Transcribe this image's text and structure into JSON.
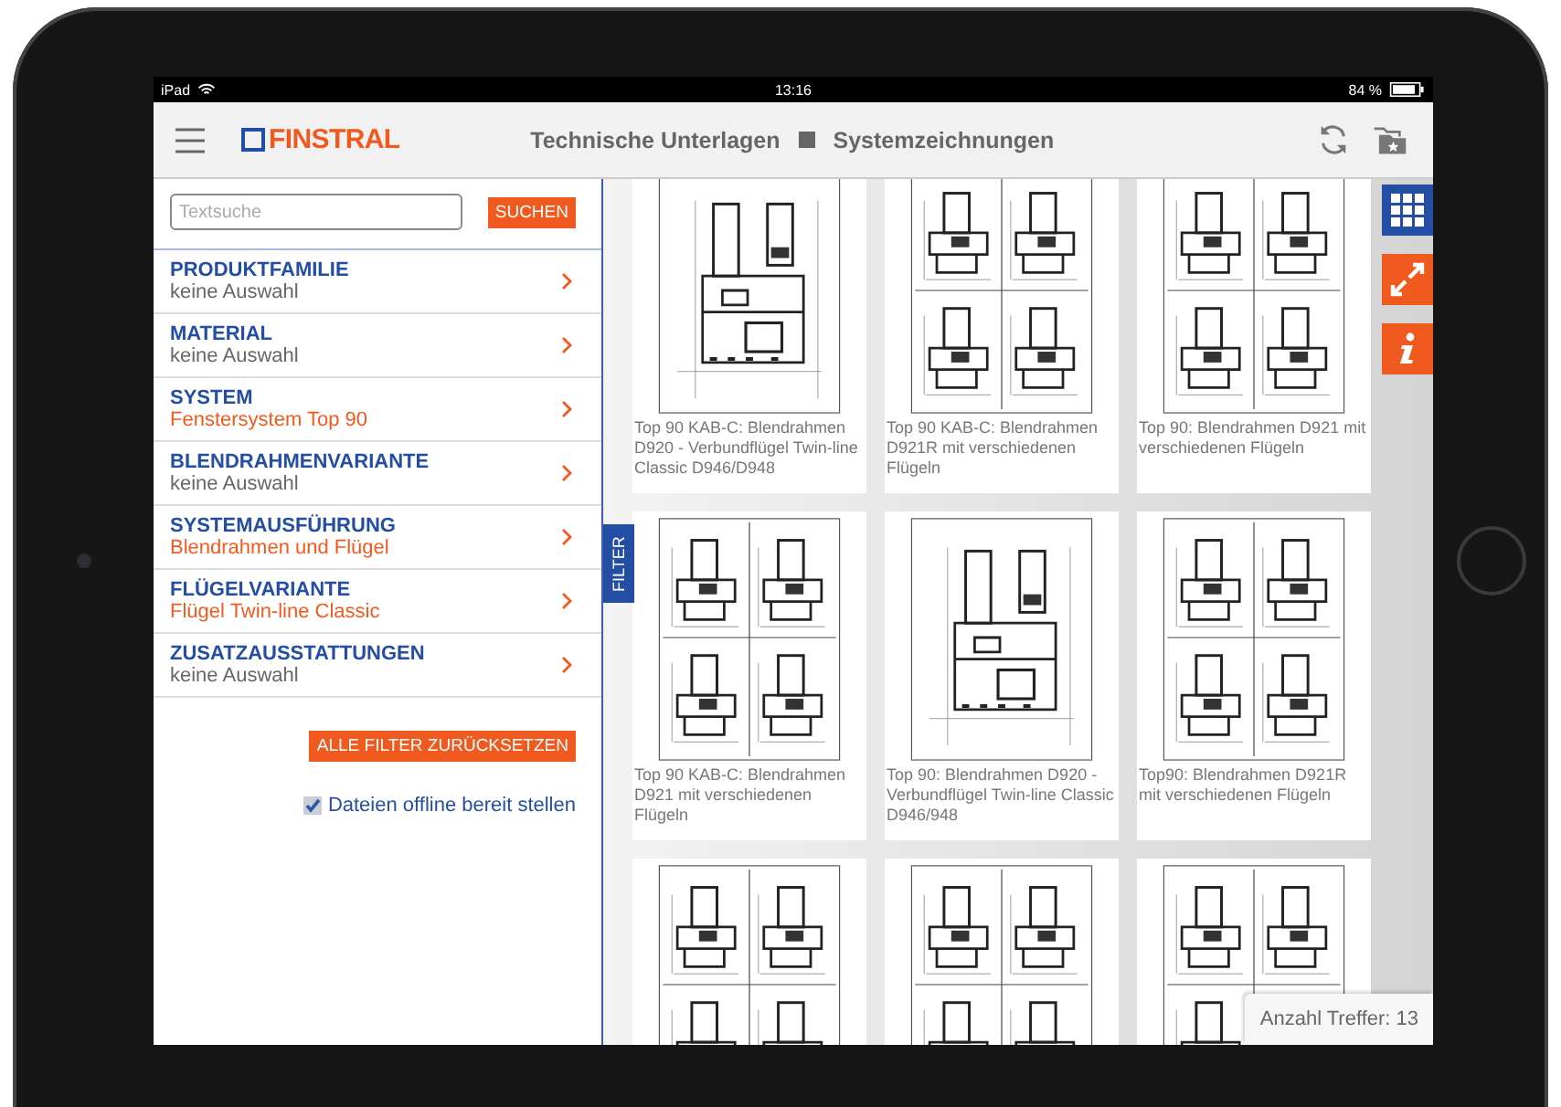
{
  "status_bar": {
    "device": "iPad",
    "time": "13:16",
    "battery": "84 %"
  },
  "header": {
    "logo": "FINSTRAL",
    "breadcrumb": [
      "Technische Unterlagen",
      "Systemzeichnungen"
    ]
  },
  "search": {
    "placeholder": "Textsuche",
    "button": "SUCHEN"
  },
  "filters": [
    {
      "title": "PRODUKTFAMILIE",
      "value": "keine Auswahl",
      "active": false
    },
    {
      "title": "MATERIAL",
      "value": "keine Auswahl",
      "active": false
    },
    {
      "title": "SYSTEM",
      "value": "Fenstersystem Top 90",
      "active": true
    },
    {
      "title": "BLENDRAHMENVARIANTE",
      "value": "keine Auswahl",
      "active": false
    },
    {
      "title": "SYSTEMAUSFÜHRUNG",
      "value": "Blendrahmen und Flügel",
      "active": true
    },
    {
      "title": "FLÜGELVARIANTE",
      "value": "Flügel Twin-line Classic",
      "active": true
    },
    {
      "title": "ZUSATZAUSSTATTUNGEN",
      "value": "keine Auswahl",
      "active": false
    }
  ],
  "reset_button": "ALLE FILTER ZURÜCKSETZEN",
  "offline": {
    "label": "Dateien offline bereit stellen",
    "checked": true
  },
  "filter_tab": "FILTER",
  "drawings": [
    {
      "kind": "single",
      "caption": "Top 90 KAB-C: Blendrahmen D920 - Verbundflügel Twin-line Classic D946/D948"
    },
    {
      "kind": "quad",
      "caption": "Top 90 KAB-C: Blendrahmen D921R mit verschiedenen Flügeln"
    },
    {
      "kind": "quad",
      "caption": "Top 90: Blendrahmen D921 mit verschiedenen Flügeln"
    },
    {
      "kind": "quad",
      "caption": "Top 90 KAB-C: Blendrahmen D921 mit verschiedenen Flügeln"
    },
    {
      "kind": "single",
      "caption": "Top 90: Blendrahmen D920 - Verbundflügel Twin-line Classic D946/948"
    },
    {
      "kind": "quad",
      "caption": "Top90: Blendrahmen D921R mit verschiedenen Flügeln"
    },
    {
      "kind": "quad"
    },
    {
      "kind": "quad"
    },
    {
      "kind": "quad"
    }
  ],
  "hit_count": "Anzahl Treffer: 13"
}
